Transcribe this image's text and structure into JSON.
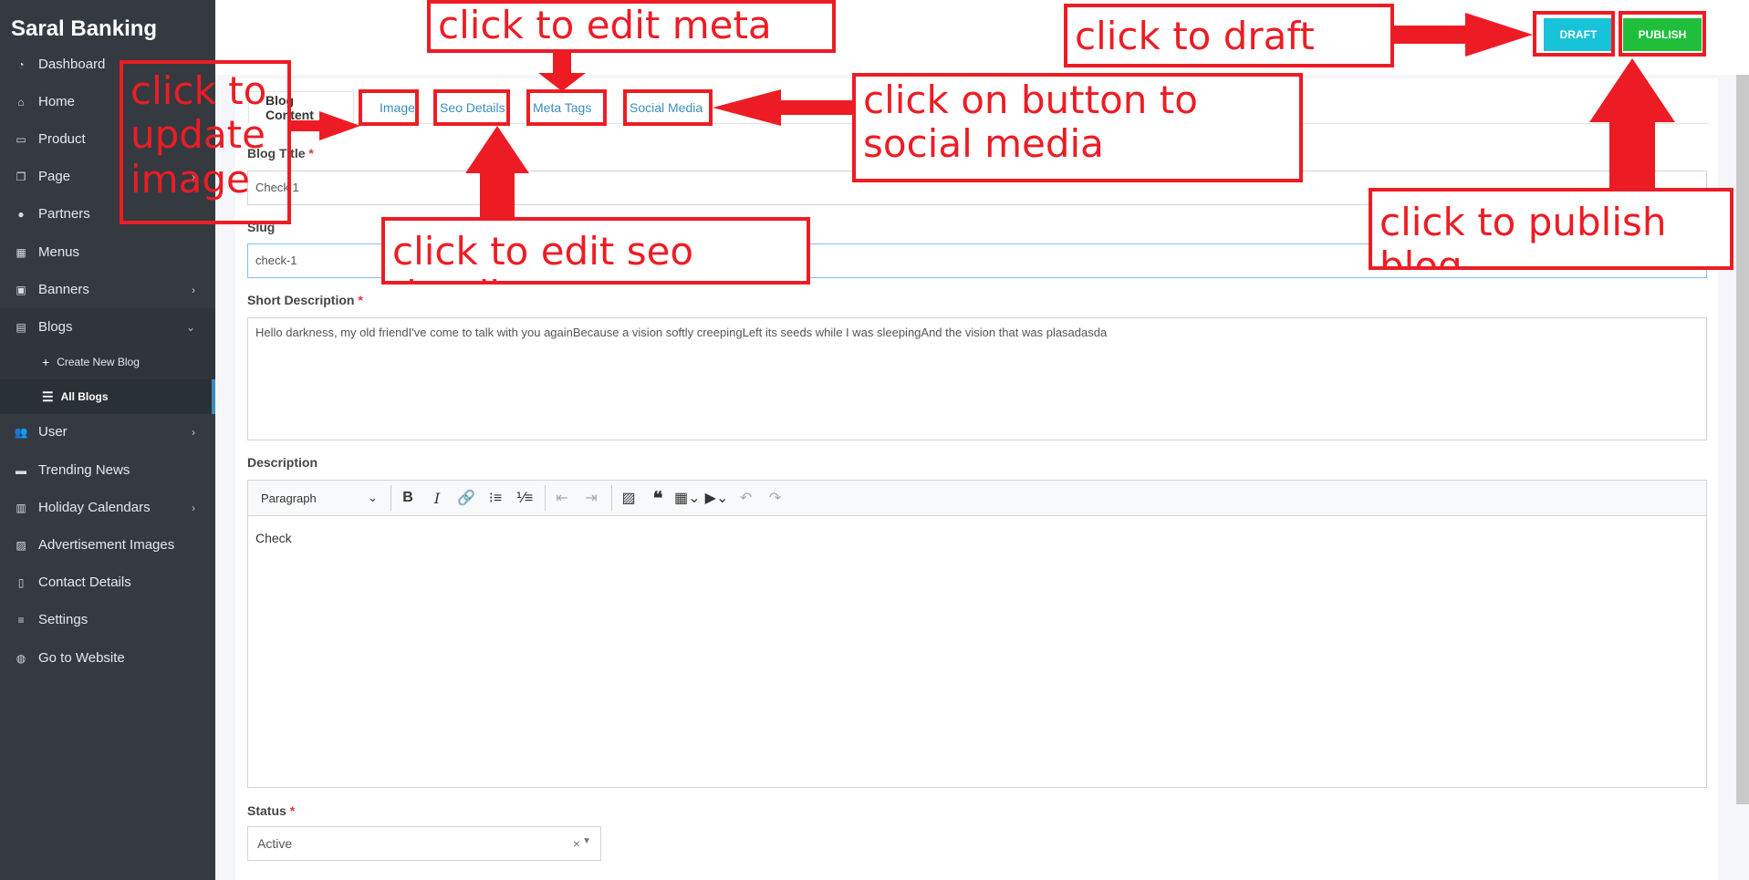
{
  "sidebar": {
    "brand": "Saral Banking",
    "items": [
      {
        "label": "Dashboard",
        "icon": "dashboard-icon"
      },
      {
        "label": "Home",
        "icon": "home-icon"
      },
      {
        "label": "Product",
        "icon": "product-icon"
      },
      {
        "label": "Page",
        "icon": "page-icon"
      },
      {
        "label": "Partners",
        "icon": "partners-icon"
      },
      {
        "label": "Menus",
        "icon": "menus-icon"
      },
      {
        "label": "Banners",
        "icon": "banners-icon"
      },
      {
        "label": "Blogs",
        "icon": "blogs-icon"
      },
      {
        "label": "User",
        "icon": "user-icon"
      },
      {
        "label": "Trending News",
        "icon": "news-icon"
      },
      {
        "label": "Holiday Calendars",
        "icon": "calendar-icon"
      },
      {
        "label": "Advertisement Images",
        "icon": "image-icon"
      },
      {
        "label": "Contact Details",
        "icon": "contact-icon"
      },
      {
        "label": "Settings",
        "icon": "settings-icon"
      },
      {
        "label": "Go to Website",
        "icon": "globe-icon"
      }
    ],
    "blogs_sub": [
      {
        "label": "Create New Blog",
        "icon": "plus-icon"
      },
      {
        "label": "All Blogs",
        "icon": "list-icon"
      }
    ]
  },
  "actions": {
    "draft": "DRAFT",
    "publish": "PUBLISH"
  },
  "tabs": [
    "Blog Content",
    "Image",
    "Seo Details",
    "Meta Tags",
    "Social Media"
  ],
  "form": {
    "title_label": "Blog Title",
    "title_value": "Check 1",
    "slug_label": "Slug",
    "slug_value": "check-1",
    "short_desc_label": "Short Description",
    "short_desc_value": "Hello darkness, my old friendI've come to talk with you againBecause a vision softly creepingLeft its seeds while I was sleepingAnd the vision that was plasadasda",
    "desc_label": "Description",
    "editor_format": "Paragraph",
    "editor_content": "Check",
    "status_label": "Status",
    "status_value": "Active",
    "required_mark": "*"
  },
  "annotations": {
    "update_image": "click to update image",
    "meta_tags": "click to edit meta tags",
    "draft": "click to draft blog",
    "social": "click on button to social media",
    "seo": "click to edit seo details",
    "publish": "click to publish blog"
  },
  "colors": {
    "sidebar_bg": "#343a40",
    "draft_btn": "#17c3d8",
    "publish_btn": "#1fbf3c",
    "annotation": "#ed1c24",
    "link": "#3c8dbc"
  }
}
